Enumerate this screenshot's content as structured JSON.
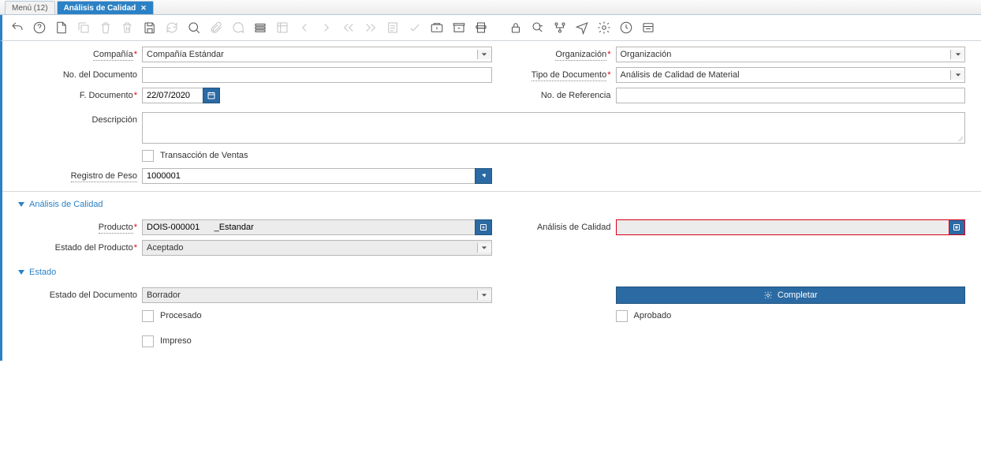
{
  "tabs": {
    "menu": "Menú (12)",
    "active": "Análisis de Calidad"
  },
  "header": {
    "compania_label": "Compañía",
    "compania_value": "Compañía Estándar",
    "organizacion_label": "Organización",
    "organizacion_value": "Organización",
    "no_documento_label": "No. del Documento",
    "no_documento_value": "",
    "tipo_documento_label": "Tipo de Documento",
    "tipo_documento_value": "Análisis de Calidad de Material",
    "f_documento_label": "F. Documento",
    "f_documento_value": "22/07/2020",
    "no_referencia_label": "No. de Referencia",
    "no_referencia_value": "",
    "descripcion_label": "Descripción",
    "descripcion_value": "",
    "transaccion_ventas_label": "Transacción de Ventas",
    "registro_peso_label": "Registro de Peso",
    "registro_peso_value": "1000001"
  },
  "analisis": {
    "section_title": "Análisis de Calidad",
    "producto_label": "Producto",
    "producto_value": "DOIS-000001      _Estandar",
    "analisis_calidad_label": "Análisis de Calidad",
    "analisis_calidad_value": "",
    "estado_producto_label": "Estado del Producto",
    "estado_producto_value": "Aceptado"
  },
  "estado": {
    "section_title": "Estado",
    "estado_documento_label": "Estado del Documento",
    "estado_documento_value": "Borrador",
    "completar_label": "Completar",
    "procesado_label": "Procesado",
    "aprobado_label": "Aprobado",
    "impreso_label": "Impreso"
  }
}
